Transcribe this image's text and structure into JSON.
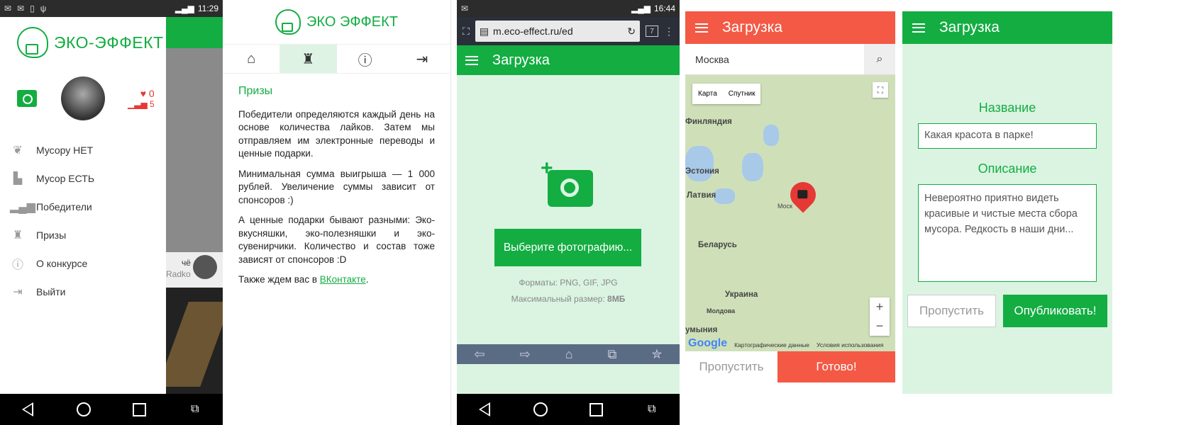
{
  "colors": {
    "brand_green": "#13ad42",
    "accent_red": "#f35944",
    "light_green_bg": "#dbf4e2"
  },
  "panel1": {
    "status_time": "11:29",
    "logo_text": "ЭКО-ЭФФЕКТ",
    "likes": "0",
    "rating": "5",
    "menu": [
      {
        "icon": "leaf-icon",
        "label": "Мусору НЕТ"
      },
      {
        "icon": "factory-icon",
        "label": "Мусор ЕСТЬ"
      },
      {
        "icon": "bars-icon",
        "label": "Победители"
      },
      {
        "icon": "trophy-icon",
        "label": "Призы"
      },
      {
        "icon": "info-icon",
        "label": "О конкурсе"
      },
      {
        "icon": "logout-icon",
        "label": "Выйти"
      }
    ],
    "behind_name": "чё",
    "behind_user": "Radko"
  },
  "panel2": {
    "logo_text": "ЭКО ЭФФЕКТ",
    "title": "Призы",
    "p1": "Победители определяются каждый день на основе количества лайков. Затем мы отправляем им электронные переводы и ценные подарки.",
    "p2": "Минимальная сумма выигрыша — 1 000 рублей. Увеличение суммы зависит от спонсоров :)",
    "p3": "А ценные подарки бывают разными: Эко-вкусняшки, эко-полезняшки и эко-сувенирчики. Количество и состав тоже зависят от спонсоров :D",
    "p4_prefix": "Также ждем вас в ",
    "p4_link": "ВКонтакте",
    "p4_suffix": "."
  },
  "panel3": {
    "status_time": "16:44",
    "url": "m.eco-effect.ru/ed",
    "tab_count": "7",
    "title": "Загрузка",
    "choose_button": "Выберите фотографию...",
    "formats_label": "Форматы: ",
    "formats_value": "PNG, GIF, JPG",
    "size_label": "Максимальный размер: ",
    "size_value": "8МБ"
  },
  "panel4": {
    "title": "Загрузка",
    "search_value": "Москва",
    "map_type_map": "Карта",
    "map_type_sat": "Спутник",
    "labels": {
      "finland": "Финляндия",
      "estonia": "Эстония",
      "latvia": "Латвия",
      "belarus": "Беларусь",
      "ukraine": "Украина",
      "moldova": "Молдова",
      "romania": "умыния",
      "moscow": "Моск"
    },
    "map_data": "Картографические данные",
    "terms": "Условия использования",
    "skip": "Пропустить",
    "done": "Готово!"
  },
  "panel5": {
    "title": "Загрузка",
    "name_label": "Название",
    "name_value": "Какая красота в парке!",
    "desc_label": "Описание",
    "desc_value": "Невероятно приятно видеть красивые и чистые места сбора мусора. Редкость в наши дни...",
    "skip": "Пропустить",
    "publish": "Опубликовать!"
  }
}
